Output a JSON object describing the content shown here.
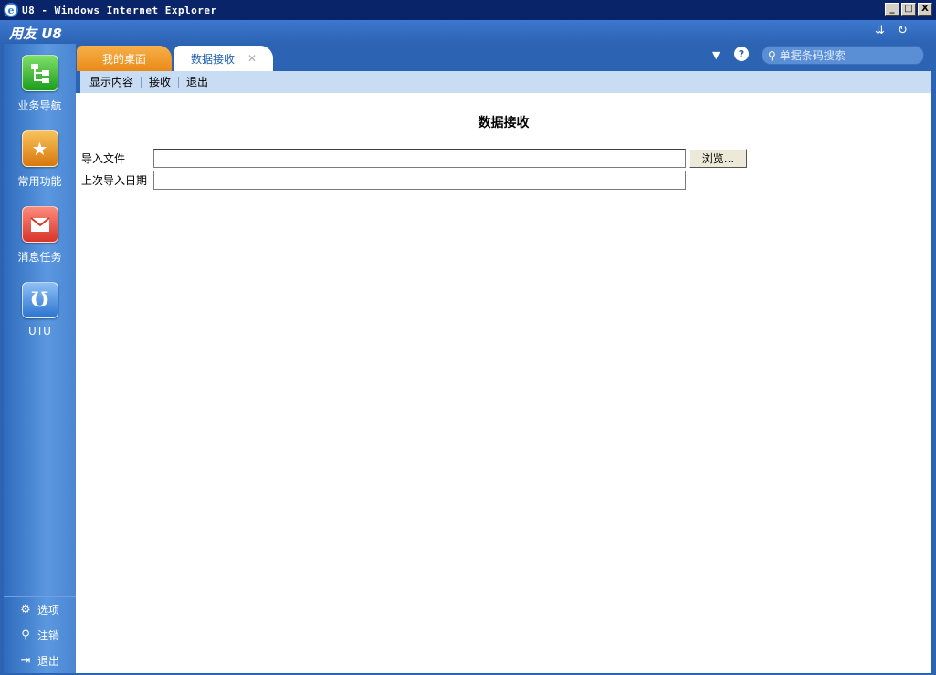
{
  "window": {
    "title": "U8 - Windows Internet Explorer",
    "minimize": "_",
    "maximize": "□",
    "close": "X"
  },
  "app": {
    "brand": "用友 U8"
  },
  "sidebar": {
    "items": [
      {
        "label": "业务导航",
        "icon": "org-chart-icon"
      },
      {
        "label": "常用功能",
        "icon": "star-folder-icon"
      },
      {
        "label": "消息任务",
        "icon": "mail-check-icon"
      },
      {
        "label": "UTU",
        "icon": "utu-icon"
      }
    ],
    "bottom": [
      {
        "label": "选项",
        "icon": "gear-icon"
      },
      {
        "label": "注销",
        "icon": "key-icon"
      },
      {
        "label": "退出",
        "icon": "exit-icon"
      }
    ]
  },
  "tabs": [
    {
      "label": "我的桌面",
      "active": false
    },
    {
      "label": "数据接收",
      "active": true
    }
  ],
  "search": {
    "placeholder": "单据条码搜索"
  },
  "toolbar": {
    "items": [
      "显示内容",
      "接收",
      "退出"
    ]
  },
  "form": {
    "title": "数据接收",
    "import_file_label": "导入文件",
    "import_file_value": "",
    "browse_label": "浏览...",
    "last_import_label": "上次导入日期",
    "last_import_value": ""
  }
}
